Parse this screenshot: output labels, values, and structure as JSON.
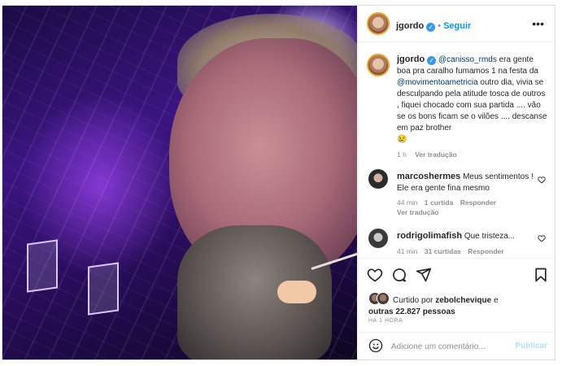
{
  "post": {
    "author": "jgordo",
    "follow_label": "Seguir",
    "more_label": "•••",
    "caption": {
      "mention": "@canisso_rmds",
      "text_1": " era gente boa pra caralho fumamos 1 na festa da ",
      "mention_2": "@movimentoametricia",
      "text_2": " outro dia, vivia se desculpando pela atitude tosca de outros , fiquei chocado com sua partida .... vão se os bons ficam se o vilões .... descanse em paz brother",
      "emoji": "😢",
      "age": "1 h",
      "translate_label": "Ver tradução"
    },
    "comments": [
      {
        "user": "marcoshermes",
        "text": "Meus sentimentos ! Ele era gente fina mesmo",
        "age": "44 min",
        "likes": "1 curtida",
        "reply_label": "Responder",
        "translate_label": "Ver tradução"
      },
      {
        "user": "rodrigolimafish",
        "text": "Que tristeza...",
        "age": "41 min",
        "likes": "31 curtidas",
        "reply_label": "Responder"
      }
    ],
    "liked_by": {
      "prefix": "Curtido por",
      "user": "zebolchevique",
      "suffix": "e",
      "others": "outras 22.827 pessoas"
    },
    "timestamp": "HÁ 1 HORA",
    "add_comment": {
      "placeholder": "Adicione um comentário...",
      "publish_label": "Publicar"
    }
  },
  "icons": [
    "heart-icon",
    "comment-icon",
    "share-icon",
    "bookmark-icon",
    "emoji-icon",
    "verified-icon",
    "more-icon"
  ],
  "colors": {
    "link": "#00376b",
    "follow": "#0095f6",
    "verified": "#3897f0",
    "muted": "#8e8e8e",
    "publish_disabled": "#b2dffc"
  }
}
